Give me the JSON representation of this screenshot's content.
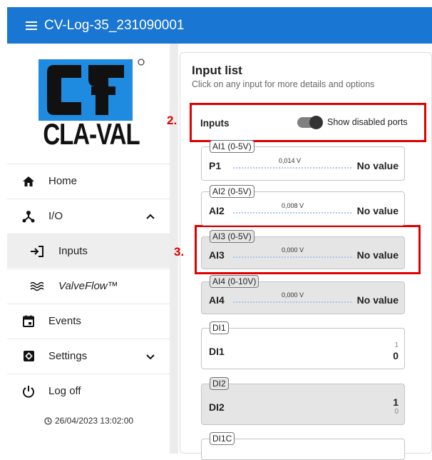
{
  "header": {
    "title": "CV-Log-35_231090001"
  },
  "logo": {
    "text": "CLA-VAL",
    "registered": "®",
    "tm": "™"
  },
  "nav": {
    "home": "Home",
    "io": "I/O",
    "inputs": "Inputs",
    "valveflow": "ValveFlow™",
    "events": "Events",
    "settings": "Settings",
    "logoff": "Log off"
  },
  "timestamp": "26/04/2023 13:02:00",
  "panel": {
    "title": "Input list",
    "subtitle": "Click on any input for more details and options",
    "inputs_label": "Inputs",
    "toggle_label": "Show disabled ports",
    "toggle_on": true
  },
  "callouts": {
    "c2": "2.",
    "c3": "3."
  },
  "cards": [
    {
      "tag": "AI1 (0-5V)",
      "name": "P1",
      "reading": "0,014 V",
      "value": "No value",
      "disabled": false
    },
    {
      "tag": "AI2 (0-5V)",
      "name": "AI2",
      "reading": "0,008 V",
      "value": "No value",
      "disabled": false
    },
    {
      "tag": "AI3 (0-5V)",
      "name": "AI3",
      "reading": "0,000 V",
      "value": "No value",
      "disabled": true
    },
    {
      "tag": "AI4 (0-10V)",
      "name": "AI4",
      "reading": "0,000 V",
      "value": "No value",
      "disabled": true
    },
    {
      "tag": "DI1",
      "name": "DI1",
      "state_top": "1",
      "state_main": "0",
      "disabled": false
    },
    {
      "tag": "DI2",
      "name": "DI2",
      "state_top": "1",
      "state_main": "0",
      "disabled": true
    },
    {
      "tag": "DI1C",
      "disabled": false
    }
  ],
  "colors": {
    "accent": "#1976d2",
    "callout": "#e00000",
    "logo_blue": "#1f8be0"
  }
}
